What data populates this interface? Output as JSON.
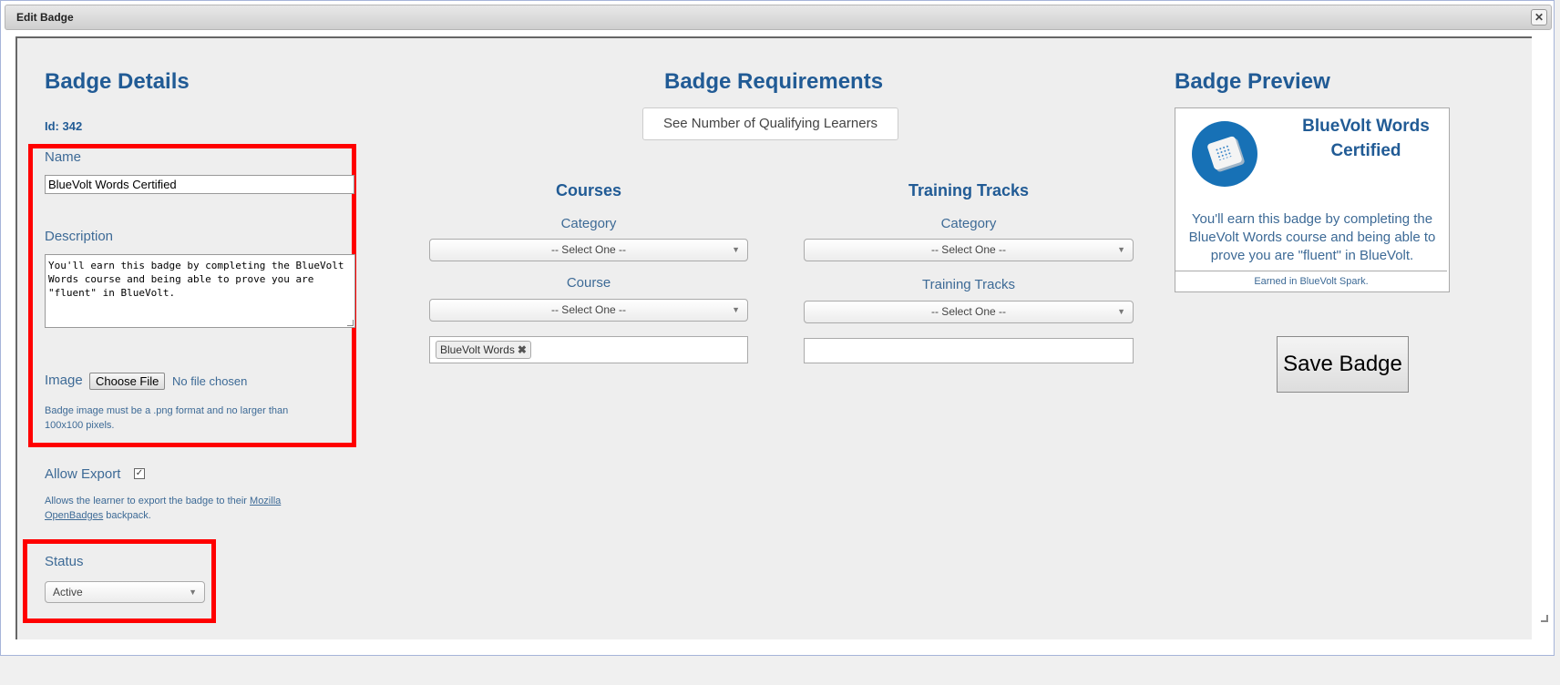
{
  "window": {
    "title": "Edit Badge",
    "close_label": "✕"
  },
  "details": {
    "heading": "Badge Details",
    "id_text": "Id: 342",
    "name_label": "Name",
    "name_value": "BlueVolt Words Certified",
    "description_label": "Description",
    "description_value": "You'll earn this badge by completing the BlueVolt Words course and being able to prove you are \"fluent\" in BlueVolt.",
    "image_label": "Image",
    "choose_file_label": "Choose File",
    "no_file_text": "No file chosen",
    "image_hint": "Badge image must be a .png format and no larger than 100x100 pixels.",
    "allow_export_label": "Allow Export",
    "allow_export_checked": "✓",
    "export_hint_prefix": "Allows the learner to export the badge to their ",
    "export_link": "Mozilla OpenBadges",
    "export_hint_suffix": " backpack.",
    "status_label": "Status",
    "status_value": "Active"
  },
  "requirements": {
    "heading": "Badge Requirements",
    "qualifying_button": "See Number of Qualifying Learners",
    "courses": {
      "heading": "Courses",
      "category_label": "Category",
      "category_value": "-- Select One --",
      "course_label": "Course",
      "course_value": "-- Select One --",
      "selected_tag": "BlueVolt Words",
      "tag_remove": "✖"
    },
    "tracks": {
      "heading": "Training Tracks",
      "category_label": "Category",
      "category_value": "-- Select One --",
      "tracks_label": "Training Tracks",
      "tracks_value": "-- Select One --"
    }
  },
  "preview": {
    "heading": "Badge Preview",
    "title": "BlueVolt Words Certified",
    "description": "You'll earn this badge by completing the BlueVolt Words course and being able to prove you are \"fluent\" in BlueVolt.",
    "footer": "Earned in BlueVolt Spark.",
    "save_button": "Save Badge"
  }
}
